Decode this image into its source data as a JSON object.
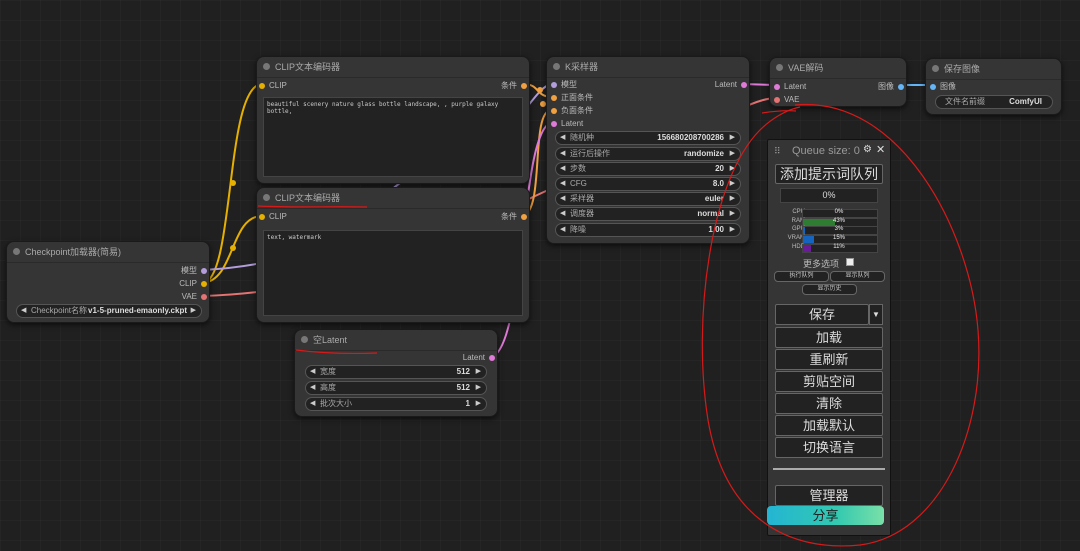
{
  "nodes": {
    "clip1": {
      "title": "CLIP文本编码器",
      "in_clip": "CLIP",
      "out_cond": "条件",
      "text": "beautiful scenery nature glass bottle landscape, , purple galaxy bottle,"
    },
    "clip2": {
      "title": "CLIP文本编码器",
      "in_clip": "CLIP",
      "out_cond": "条件",
      "text": "text, watermark"
    },
    "ckpt": {
      "title": "Checkpoint加载器(简易)",
      "out_model": "模型",
      "out_clip": "CLIP",
      "out_vae": "VAE",
      "widget_label": "Checkpoint名称",
      "widget_value": "v1-5-pruned-emaonly.ckpt"
    },
    "latent": {
      "title": "空Latent",
      "out_latent": "Latent",
      "widgets": [
        {
          "label": "宽度",
          "value": "512"
        },
        {
          "label": "高度",
          "value": "512"
        },
        {
          "label": "批次大小",
          "value": "1"
        }
      ]
    },
    "ksampler": {
      "title": "K采样器",
      "in_model": "模型",
      "in_pos": "正面条件",
      "in_neg": "负面条件",
      "in_latent": "Latent",
      "out_latent": "Latent",
      "widgets": [
        {
          "label": "随机种",
          "value": "156680208700286"
        },
        {
          "label": "运行后操作",
          "value": "randomize"
        },
        {
          "label": "步数",
          "value": "20"
        },
        {
          "label": "CFG",
          "value": "8.0"
        },
        {
          "label": "采样器",
          "value": "euler"
        },
        {
          "label": "调度器",
          "value": "normal"
        },
        {
          "label": "降噪",
          "value": "1.00"
        }
      ]
    },
    "vae": {
      "title": "VAE解码",
      "in_latent": "Latent",
      "in_vae": "VAE",
      "out_image": "图像"
    },
    "save": {
      "title": "保存图像",
      "in_image": "图像",
      "widget_label": "文件名前缀",
      "widget_value": "ComfyUI"
    }
  },
  "panel": {
    "queue_label": "Queue size: 0",
    "queue_prompt": "添加提示词队列",
    "progress": "0%",
    "stats": [
      {
        "label": "CPU",
        "value": "0%",
        "fraction": 0.0,
        "color": "#2e7d32"
      },
      {
        "label": "RAM",
        "value": "43%",
        "fraction": 0.43,
        "color": "#2e7d32"
      },
      {
        "label": "GPU",
        "value": "3%",
        "fraction": 0.03,
        "color": "#1565c0"
      },
      {
        "label": "VRAM",
        "value": "15%",
        "fraction": 0.15,
        "color": "#1565c0"
      },
      {
        "label": "HDD",
        "value": "11%",
        "fraction": 0.11,
        "color": "#6a1b9a"
      }
    ],
    "extra_options": "更多选项",
    "view_queue": "执行队列",
    "view_history_queue": "显示队列",
    "view_history": "显示历史",
    "save": "保存",
    "load": "加载",
    "refresh": "重刷新",
    "clipspace": "剪贴空间",
    "clear": "清除",
    "load_default": "加载默认",
    "switch_locale": "切换语言",
    "manager": "管理器",
    "share": "分享"
  },
  "colors": {
    "clip_wire": "#e6b000",
    "model_wire": "#b39ddb",
    "vae_wire": "#e57373",
    "cond_wire": "#f0a040",
    "latent_wire": "#e07ad8",
    "image_wire": "#64b5f6",
    "annotation": "#d61a1a"
  }
}
